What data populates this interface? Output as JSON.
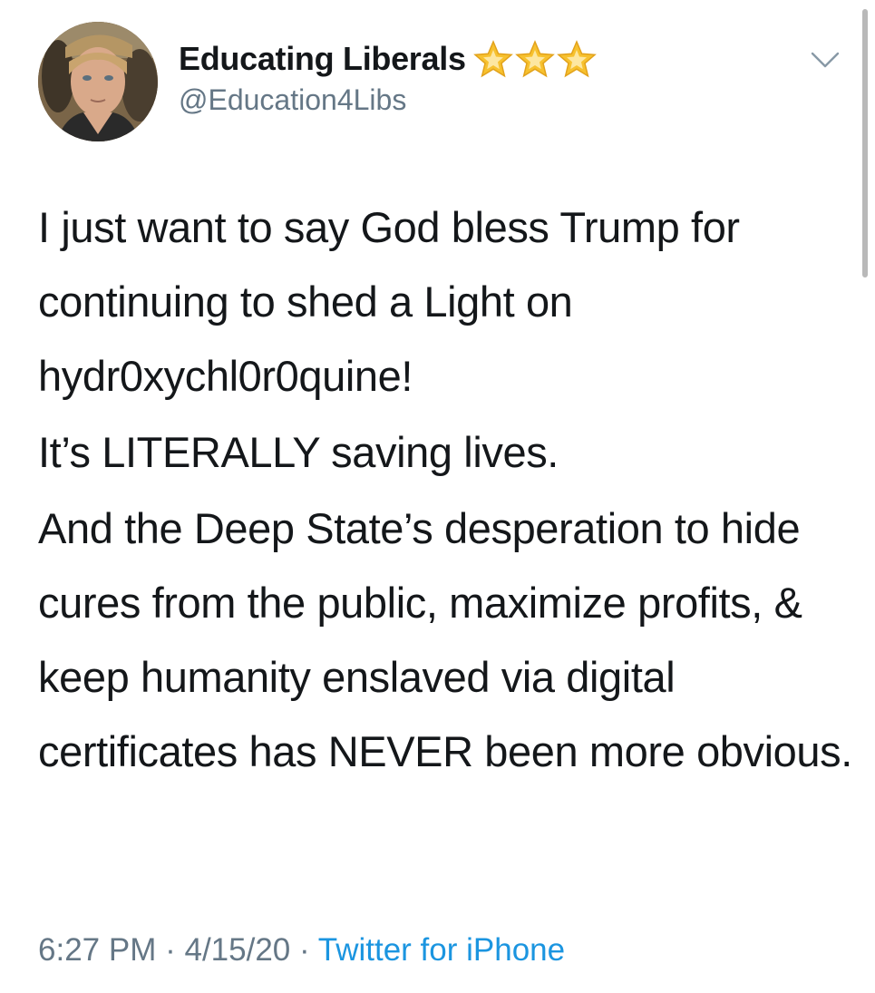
{
  "user": {
    "display_name": "Educating Liberals",
    "handle": "@Education4Libs",
    "badge_icons": [
      "star-icon",
      "star-icon",
      "star-icon"
    ],
    "badge_color": "#f7c12e"
  },
  "tweet": {
    "lines": [
      "I just want to say God bless Trump for continuing to shed a Light on hydr0xychl0r0quine!",
      "It’s LITERALLY saving lives.",
      "And the Deep State’s desperation to hide cures from the public, maximize profits, & keep humanity enslaved via digital certificates has NEVER been more obvious."
    ]
  },
  "meta": {
    "time": "6:27 PM",
    "separator": "·",
    "date": "4/15/20",
    "source": "Twitter for iPhone"
  },
  "colors": {
    "text": "#14171a",
    "secondary": "#657786",
    "link": "#1b95e0"
  },
  "icons": {
    "menu": "chevron-down-icon"
  }
}
